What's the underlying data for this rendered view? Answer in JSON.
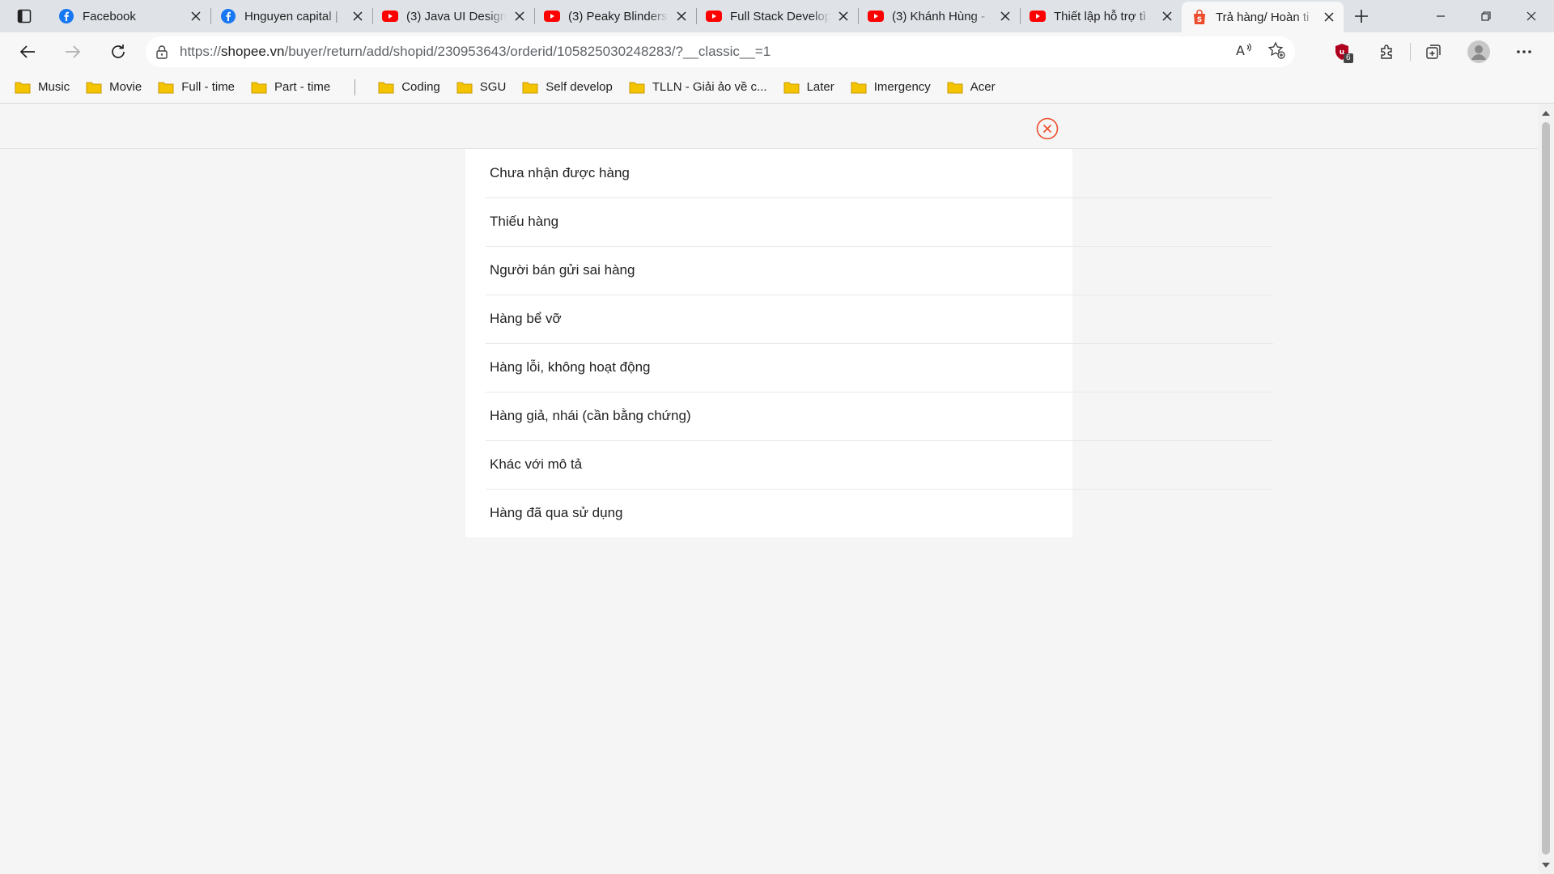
{
  "browser": {
    "tabs": [
      {
        "title": "Facebook",
        "icon": "facebook-icon",
        "active": false
      },
      {
        "title": "Hnguyen capital |",
        "icon": "facebook-icon",
        "active": false
      },
      {
        "title": "(3) Java UI Design",
        "icon": "youtube-icon",
        "active": false
      },
      {
        "title": "(3) Peaky Blinders",
        "icon": "youtube-icon",
        "active": false
      },
      {
        "title": "Full Stack Develop",
        "icon": "youtube-icon",
        "active": false
      },
      {
        "title": "(3) Khánh Hùng -",
        "icon": "youtube-icon",
        "active": false
      },
      {
        "title": "Thiết lập hỗ trợ tì",
        "icon": "youtube-icon",
        "active": false
      },
      {
        "title": "Trả hàng/ Hoàn ti",
        "icon": "shopee-icon",
        "active": true
      }
    ],
    "url_prefix": "https://",
    "url_host": "shopee.vn",
    "url_path": "/buyer/return/add/shopid/230953643/orderid/105825030248283/?__classic__=1",
    "extension_badge": "6",
    "bookmarks": [
      "Music",
      "Movie",
      "Full - time",
      "Part - time",
      "Coding",
      "SGU",
      "Self develop",
      "TLLN - Giải ảo về c...",
      "Later",
      "Imergency",
      "Acer"
    ]
  },
  "page": {
    "reasons": [
      "Chưa nhận được hàng",
      "Thiếu hàng",
      "Người bán gửi sai hàng",
      "Hàng bể vỡ",
      "Hàng lỗi, không hoạt động",
      "Hàng giả, nhái (cần bằng chứng)",
      "Khác với mô tả",
      "Hàng đã qua sử dụng"
    ]
  },
  "colors": {
    "accent": "#ee4d2d",
    "youtube": "#ff0000",
    "facebook": "#1877f2",
    "folder": "#f5c400"
  }
}
